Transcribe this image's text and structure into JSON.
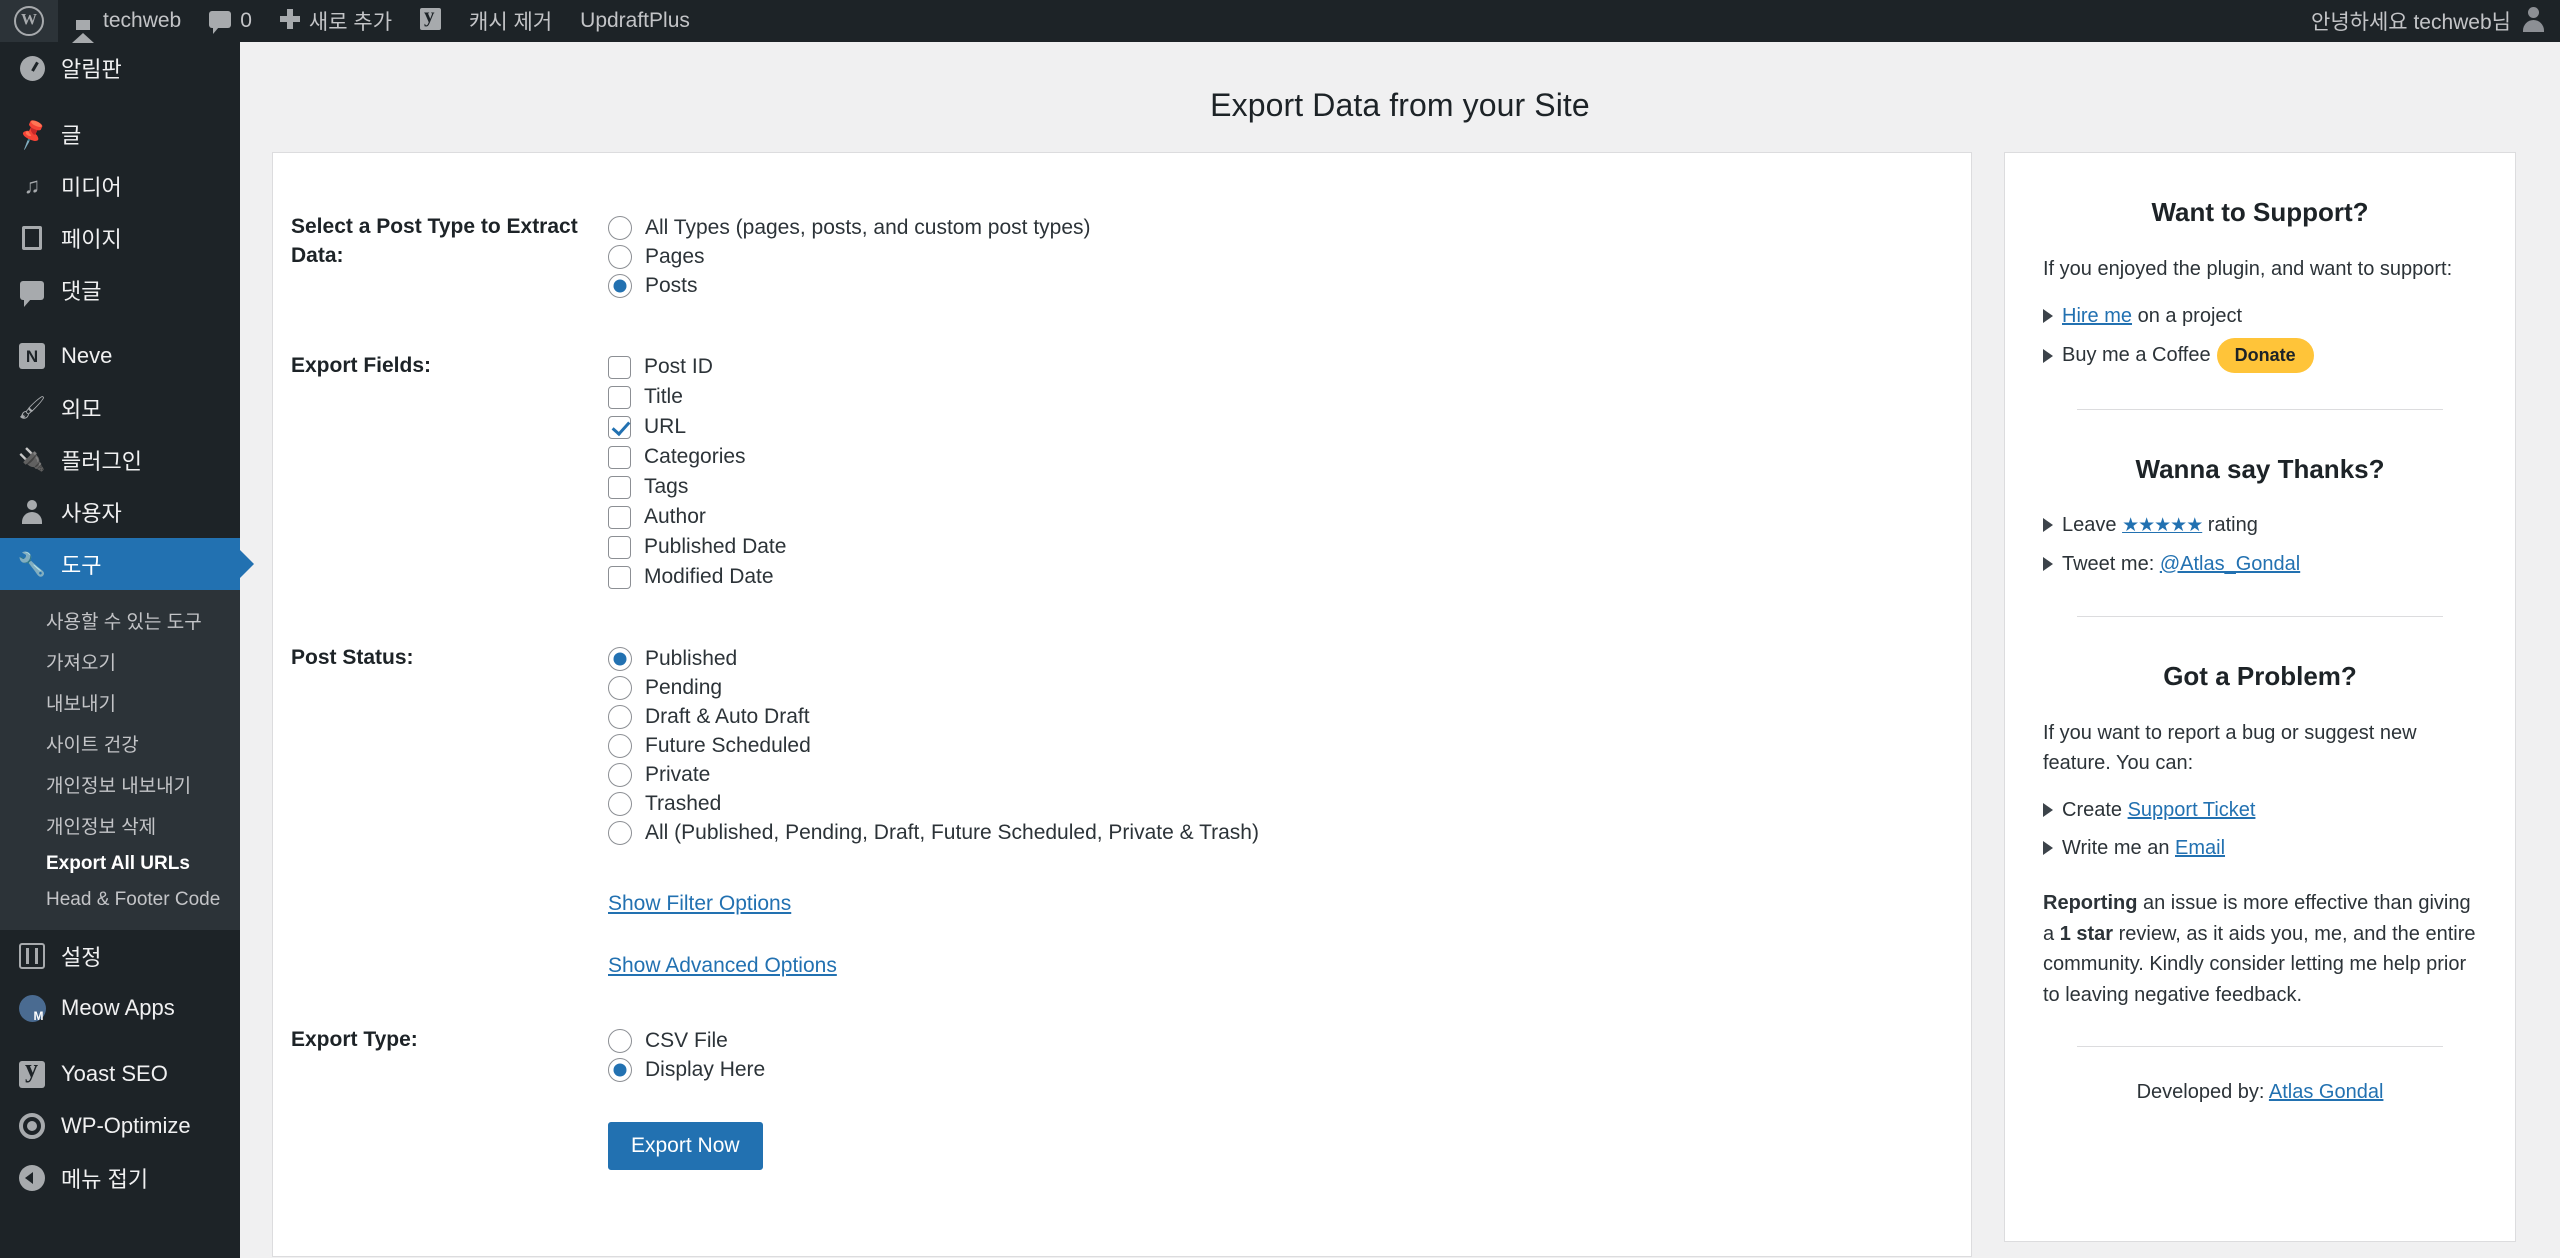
{
  "adminbar": {
    "logo": "wordpress-logo",
    "site_name": "techweb",
    "comment_count": "0",
    "new_label": "새로 추가",
    "cache_label": "캐시 제거",
    "updraft_label": "UpdraftPlus",
    "greeting": "안녕하세요 techweb님"
  },
  "sidebar": {
    "groups": [
      {
        "items": [
          {
            "label": "알림판",
            "icon": "dashboard-icon",
            "current": false
          }
        ]
      },
      {
        "items": [
          {
            "label": "글",
            "icon": "posts-pin-icon",
            "current": false
          },
          {
            "label": "미디어",
            "icon": "media-icon",
            "current": false
          },
          {
            "label": "페이지",
            "icon": "pages-icon",
            "current": false
          },
          {
            "label": "댓글",
            "icon": "comments-icon",
            "current": false
          }
        ]
      },
      {
        "items": [
          {
            "label": "Neve",
            "icon": "neve-icon",
            "current": false
          },
          {
            "label": "외모",
            "icon": "appearance-brush-icon",
            "current": false
          },
          {
            "label": "플러그인",
            "icon": "plugins-plug-icon",
            "current": false
          },
          {
            "label": "사용자",
            "icon": "users-icon",
            "current": false
          },
          {
            "label": "도구",
            "icon": "tools-wrench-icon",
            "current": true
          }
        ]
      }
    ],
    "submenu": [
      {
        "label": "사용할 수 있는 도구",
        "current": false
      },
      {
        "label": "가져오기",
        "current": false
      },
      {
        "label": "내보내기",
        "current": false
      },
      {
        "label": "사이트 건강",
        "current": false
      },
      {
        "label": "개인정보 내보내기",
        "current": false
      },
      {
        "label": "개인정보 삭제",
        "current": false
      },
      {
        "label": "Export All URLs",
        "current": true
      },
      {
        "label": "Head & Footer Code",
        "current": false
      }
    ],
    "bottom_groups": [
      {
        "items": [
          {
            "label": "설정",
            "icon": "settings-icon",
            "current": false
          },
          {
            "label": "Meow Apps",
            "icon": "meow-apps-icon",
            "current": false
          }
        ]
      },
      {
        "items": [
          {
            "label": "Yoast SEO",
            "icon": "yoast-seo-icon",
            "current": false
          },
          {
            "label": "WP-Optimize",
            "icon": "wp-optimize-icon",
            "current": false
          },
          {
            "label": "메뉴 접기",
            "icon": "collapse-menu-icon",
            "current": false
          }
        ]
      }
    ]
  },
  "page": {
    "title": "Export Data from your Site"
  },
  "form": {
    "post_type": {
      "label": "Select a Post Type to Extract Data:",
      "options": [
        {
          "label": "All Types (pages, posts, and custom post types)",
          "selected": false
        },
        {
          "label": "Pages",
          "selected": false
        },
        {
          "label": "Posts",
          "selected": true
        }
      ]
    },
    "export_fields": {
      "label": "Export Fields:",
      "options": [
        {
          "label": "Post ID",
          "checked": false
        },
        {
          "label": "Title",
          "checked": false
        },
        {
          "label": "URL",
          "checked": true
        },
        {
          "label": "Categories",
          "checked": false
        },
        {
          "label": "Tags",
          "checked": false
        },
        {
          "label": "Author",
          "checked": false
        },
        {
          "label": "Published Date",
          "checked": false
        },
        {
          "label": "Modified Date",
          "checked": false
        }
      ]
    },
    "post_status": {
      "label": "Post Status:",
      "options": [
        {
          "label": "Published",
          "selected": true
        },
        {
          "label": "Pending",
          "selected": false
        },
        {
          "label": "Draft & Auto Draft",
          "selected": false
        },
        {
          "label": "Future Scheduled",
          "selected": false
        },
        {
          "label": "Private",
          "selected": false
        },
        {
          "label": "Trashed",
          "selected": false
        },
        {
          "label": "All (Published, Pending, Draft, Future Scheduled, Private & Trash)",
          "selected": false
        }
      ]
    },
    "filter_toggle": "Show Filter Options",
    "advanced_toggle": "Show Advanced Options",
    "export_type": {
      "label": "Export Type:",
      "options": [
        {
          "label": "CSV File",
          "selected": false
        },
        {
          "label": "Display Here",
          "selected": true
        }
      ]
    },
    "submit_label": "Export Now"
  },
  "support": {
    "support_heading": "Want to Support?",
    "support_intro": "If you enjoyed the plugin, and want to support:",
    "hire_prefix": "",
    "hire_link": "Hire me",
    "hire_suffix": " on a project",
    "coffee_text": "Buy me a Coffee",
    "donate_label": "Donate",
    "thanks_heading": "Wanna say Thanks?",
    "rating_prefix": "Leave ",
    "rating_stars": "★★★★★",
    "rating_suffix": " rating",
    "tweet_prefix": "Tweet me: ",
    "tweet_handle": "@Atlas_Gondal",
    "problem_heading": "Got a Problem?",
    "problem_intro": "If you want to report a bug or suggest new feature. You can:",
    "ticket_prefix": "Create ",
    "ticket_link": "Support Ticket",
    "email_prefix": "Write me an ",
    "email_link": "Email",
    "reporting_bold": "Reporting",
    "reporting_mid": " an issue is more effective than giving a ",
    "reporting_bold2": "1 star",
    "reporting_end": " review, as it aids you, me, and the entire community. Kindly consider letting me help prior to leaving negative feedback.",
    "developed_prefix": "Developed by: ",
    "developed_link": "Atlas Gondal"
  },
  "colors": {
    "accent": "#2271b1",
    "adminbar_bg": "#1d2327",
    "sidebar_bg": "#1d2327",
    "submenu_bg": "#2c3338",
    "donate_yellow": "#ffc439",
    "page_bg": "#f0f0f1"
  }
}
